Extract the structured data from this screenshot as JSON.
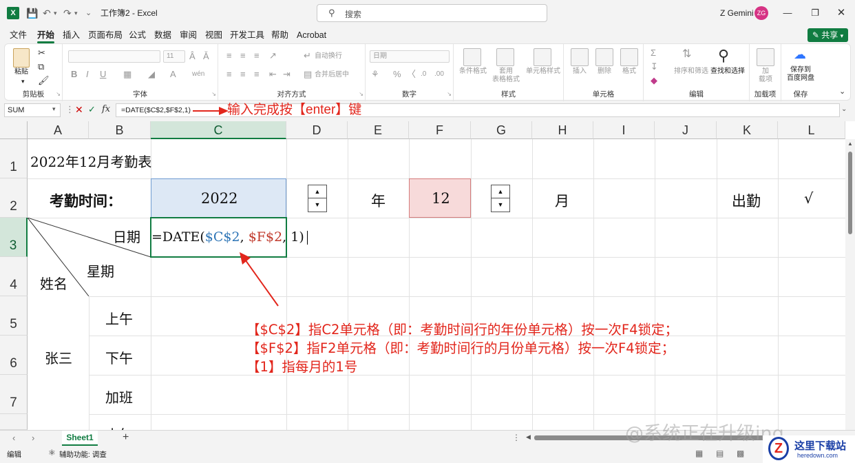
{
  "window": {
    "title": "工作簿2 - Excel",
    "app_logo": "X",
    "search_placeholder": "搜索",
    "user_name": "Z Gemini",
    "user_initials": "ZG"
  },
  "menu": {
    "tabs": [
      "文件",
      "开始",
      "插入",
      "页面布局",
      "公式",
      "数据",
      "审阅",
      "视图",
      "开发工具",
      "帮助",
      "Acrobat"
    ],
    "active": "开始",
    "share_label": "共享"
  },
  "ribbon": {
    "clipboard": {
      "label": "剪贴板",
      "paste": "粘贴"
    },
    "font": {
      "label": "字体",
      "font_size": "11"
    },
    "alignment": {
      "label": "对齐方式",
      "wrap": "自动换行",
      "merge": "合并后居中"
    },
    "number": {
      "label": "数字",
      "format": "日期"
    },
    "styles": {
      "label": "样式",
      "conditional": "条件格式",
      "table": "套用\n表格格式",
      "cell_styles": "单元格样式"
    },
    "cells": {
      "label": "单元格",
      "insert": "插入",
      "delete": "删除",
      "format": "格式"
    },
    "editing": {
      "label": "编辑",
      "sort": "排序和筛选",
      "find": "查找和选择"
    },
    "addins": {
      "label": "加载项",
      "addin": "加\n载项"
    },
    "save": {
      "label": "保存",
      "save_baidu": "保存到\n百度网盘"
    }
  },
  "formula_bar": {
    "name_box": "SUM",
    "formula": "=DATE($C$2,$F$2,1)",
    "annotation": "输入完成按【enter】键"
  },
  "columns": [
    "A",
    "B",
    "C",
    "D",
    "E",
    "F",
    "G",
    "H",
    "I",
    "J",
    "K",
    "L"
  ],
  "rows": [
    "1",
    "2",
    "3",
    "4",
    "5",
    "6",
    "7"
  ],
  "cells": {
    "A1": "2022年12月考勤表",
    "A2": "考勤时间：",
    "C2": "2022",
    "E2": "年",
    "F2": "12",
    "H2": "月",
    "K2": "出勤",
    "L2": "√",
    "B3": "日期",
    "C3_prefix": "=DATE(",
    "C3_ref1": "$C$2",
    "C3_sep1": ",",
    "C3_ref2": "$F$2",
    "C3_suffix": ", 1)",
    "B4": "星期",
    "A4": "姓名",
    "B5": "上午",
    "B6": "下午",
    "A6": "张三",
    "B7": "加班",
    "B8": "小午"
  },
  "annotations": [
    "【$C$2】指C2单元格（即：考勤时间行的年份单元格）按一次F4锁定；",
    "【$F$2】指F2单元格（即：考勤时间行的月份单元格）按一次F4锁定；",
    "【1】指每月的1号"
  ],
  "sheets": {
    "tabs": [
      "Sheet1"
    ],
    "add": "+"
  },
  "status": {
    "mode": "编辑",
    "accessibility": "辅助功能: 调查"
  },
  "watermark": "@系统正在升级ing",
  "site_logo": {
    "name": "这里下载站",
    "url": "heredown.com"
  },
  "colors": {
    "accent": "#107c41",
    "annotation": "#e2261c",
    "ref_blue": "#2e75b6",
    "ref_red": "#c0392b",
    "year_fill": "#dde8f5",
    "month_fill": "#f7dada"
  }
}
